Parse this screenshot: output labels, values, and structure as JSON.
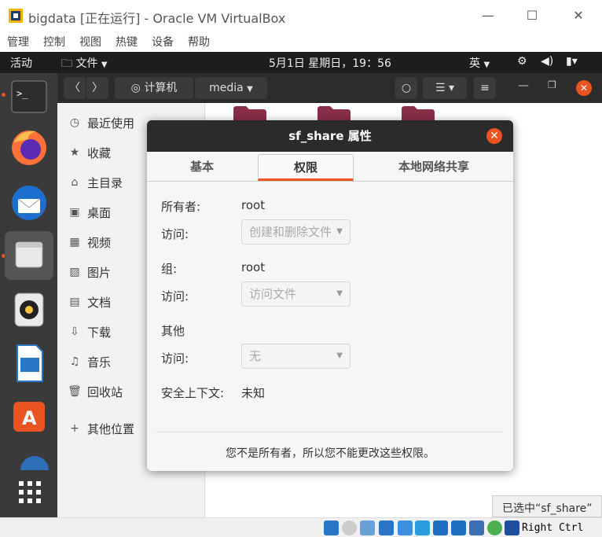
{
  "window": {
    "title": "bigdata [正在运行] - Oracle VM VirtualBox",
    "menu": [
      "管理",
      "控制",
      "视图",
      "热键",
      "设备",
      "帮助"
    ]
  },
  "gnome": {
    "activities": "活动",
    "app_menu": "文件",
    "clock": "5月1日 星期日，19：56",
    "input_method": "英"
  },
  "file_manager": {
    "path": [
      "计算机",
      "media"
    ],
    "sidebar": [
      {
        "label": "最近使用",
        "icon": "clock-icon"
      },
      {
        "label": "收藏",
        "icon": "star-icon"
      },
      {
        "label": "主目录",
        "icon": "home-icon"
      },
      {
        "label": "桌面",
        "icon": "desktop-icon"
      },
      {
        "label": "视频",
        "icon": "video-icon"
      },
      {
        "label": "图片",
        "icon": "picture-icon"
      },
      {
        "label": "文档",
        "icon": "document-icon"
      },
      {
        "label": "下载",
        "icon": "download-icon"
      },
      {
        "label": "音乐",
        "icon": "music-icon"
      },
      {
        "label": "回收站",
        "icon": "trash-icon"
      },
      {
        "label": "其他位置",
        "icon": "plus-icon"
      }
    ],
    "status": "已选中“sf_share”"
  },
  "dialog": {
    "title": "sf_share 属性",
    "tabs": [
      "基本",
      "权限",
      "本地网络共享"
    ],
    "active_tab": "权限",
    "owner_label": "所有者:",
    "owner_value": "root",
    "owner_access_label": "访问:",
    "owner_access_value": "创建和删除文件",
    "group_label": "组:",
    "group_value": "root",
    "group_access_label": "访问:",
    "group_access_value": "访问文件",
    "others_label": "其他",
    "others_access_label": "访问:",
    "others_access_value": "无",
    "security_context_label": "安全上下文:",
    "security_context_value": "未知",
    "footer_note": "您不是所有者，所以您不能更改这些权限。"
  },
  "tray": {
    "host_key": "Right Ctrl"
  },
  "colors": {
    "accent": "#e95420",
    "topbar": "#1d1d1d",
    "dock": "#3a3a3a",
    "header": "#2c2c2c"
  }
}
